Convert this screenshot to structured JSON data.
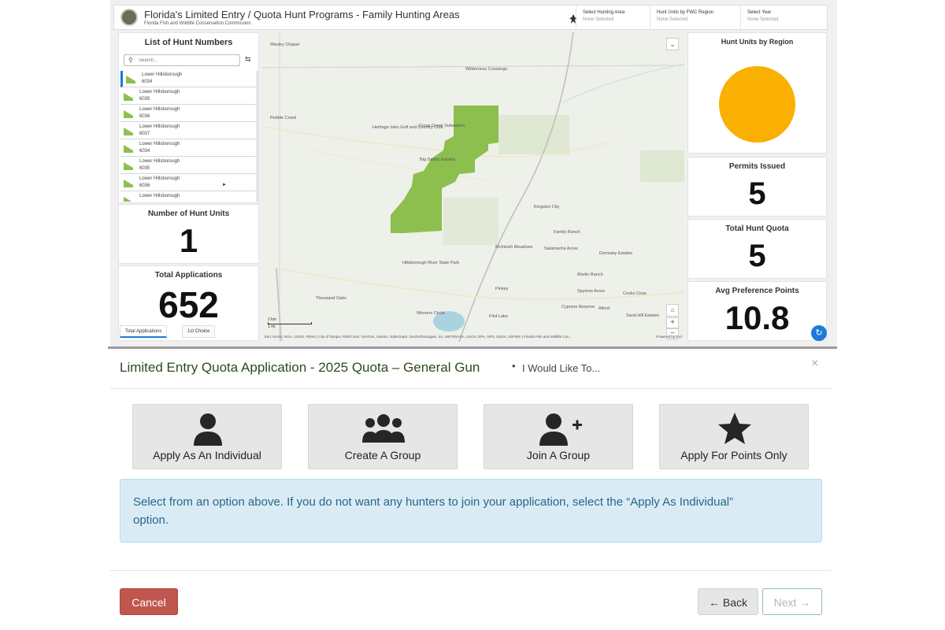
{
  "dashboard": {
    "title": "Florida's Limited Entry / Quota Hunt Programs - Family Hunting Areas",
    "subtitle": "Florida Fish and Wildlife Conservation Commission",
    "filters": [
      {
        "label": "Select Hunting Area",
        "value": "None Selected"
      },
      {
        "label": "Hunt Units by FWC Region",
        "value": "None Selected"
      },
      {
        "label": "Select Year",
        "value": "None Selected"
      }
    ],
    "hunt_list": {
      "title": "List of Hunt Numbers",
      "search_placeholder": "Search...",
      "items": [
        {
          "name": "Lower Hillsborough",
          "number": "6034"
        },
        {
          "name": "Lower Hillsborough",
          "number": "6035"
        },
        {
          "name": "Lower Hillsborough",
          "number": "6036"
        },
        {
          "name": "Lower Hillsborough",
          "number": "6037"
        },
        {
          "name": "Lower Hillsborough",
          "number": "6034"
        },
        {
          "name": "Lower Hillsborough",
          "number": "6035"
        },
        {
          "name": "Lower Hillsborough",
          "number": "6036"
        },
        {
          "name": "Lower Hillsborough",
          "number": ""
        }
      ],
      "swatch_color": "#8fbf4f"
    },
    "stats": {
      "hunt_units": {
        "label": "Number of Hunt Units",
        "value": "1"
      },
      "total_applications": {
        "label": "Total Applications",
        "value": "652"
      },
      "permits_issued": {
        "label": "Permits Issued",
        "value": "5"
      },
      "total_hunt_quota": {
        "label": "Total Hunt Quota",
        "value": "5"
      },
      "avg_preference_points": {
        "label": "Avg Preference Points",
        "value": "10.8"
      }
    },
    "tabs": [
      "Total Applications",
      "1st Choice"
    ],
    "region_chart": {
      "title": "Hunt Units by Region",
      "color": "#f9b000",
      "share": 1.0
    },
    "map": {
      "labels": [
        "Wesley Chapel",
        "Pebble Creek",
        "Wilderness Crossings",
        "Cross Creek Substation",
        "Heritage Isles Golf and Country Club",
        "Big Daddy Estates",
        "Kingston City",
        "Family Ranch",
        "Dormany Estates",
        "Salamacha Acres",
        "McIntosh Meadows",
        "Hillsborough River State Park",
        "Martin Ranch",
        "Thousand Oaks",
        "Pinkey",
        "Cypress Reserve",
        "Cooks Cove",
        "Flint Lake",
        "Sand Hill Estates",
        "Winners Circle",
        "Alford",
        "Spyress Acres"
      ],
      "scale_km": "2 km",
      "scale_mi": "1 mi",
      "attribution": "Esri, NASA, NGA, USGS, FEMA | City of Tampa, FDEP, Esri, TomTom, Garmin, SafeGraph, GeoTechnologies, Inc, METI/NASA, USGS, EPA, NPS, USDA, USFWS | Florida Fish and Wildlife Con...",
      "powered_by": "Powered by Esri",
      "area_color": "#8cbf4e"
    }
  },
  "modal": {
    "title": "Limited Entry Quota Application - 2025 Quota – General Gun",
    "separator": "•",
    "subtitle": "I Would Like To...",
    "close": "×",
    "options": [
      {
        "label": "Apply As An Individual",
        "icon": "person-icon"
      },
      {
        "label": "Create A Group",
        "icon": "group-icon"
      },
      {
        "label": "Join A Group",
        "icon": "person-add-icon"
      },
      {
        "label": "Apply For Points Only",
        "icon": "star-icon"
      }
    ],
    "info": "Select from an option above. If you do not want any hunters to join your application, select the “Apply As Individual” option.",
    "buttons": {
      "cancel": "Cancel",
      "back": "← Back",
      "next": "Next →"
    }
  },
  "colors": {
    "cancel": "#c0574f",
    "info_bg": "#d9ecf6",
    "info_text": "#2a6586",
    "title_text": "#2d4a1f",
    "selection_accent": "#1c7bd6"
  }
}
